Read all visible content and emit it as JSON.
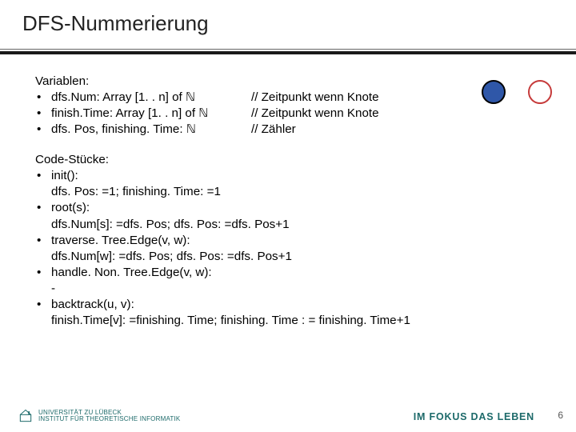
{
  "title": "DFS-Nummerierung",
  "variables": {
    "heading": "Variablen:",
    "items": [
      {
        "decl": "dfs.Num: Array [1. . n] of ℕ",
        "comment": "// Zeitpunkt wenn Knote"
      },
      {
        "decl": "finish.Time: Array [1. . n] of ℕ",
        "comment": "// Zeitpunkt wenn Knote"
      },
      {
        "decl": "dfs. Pos, finishing. Time: ℕ",
        "comment": "// Zähler"
      }
    ]
  },
  "code": {
    "heading": "Code-Stücke:",
    "items": [
      {
        "name": "init():",
        "body": "dfs. Pos: =1; finishing. Time: =1"
      },
      {
        "name": "root(s):",
        "body": "dfs.Num[s]: =dfs. Pos; dfs. Pos: =dfs. Pos+1"
      },
      {
        "name": "traverse. Tree.Edge(v, w):",
        "body": "dfs.Num[w]: =dfs. Pos; dfs. Pos: =dfs. Pos+1"
      },
      {
        "name": "handle. Non. Tree.Edge(v, w):",
        "body": "-"
      },
      {
        "name": "backtrack(u, v):",
        "body": "finish.Time[v]: =finishing. Time; finishing. Time : = finishing. Time+1"
      }
    ]
  },
  "footer": {
    "logo_line1": "UNIVERSITÄT ZU LÜBECK",
    "logo_line2": "INSTITUT FÜR THEORETISCHE INFORMATIK",
    "tagline": "IM FOKUS DAS LEBEN",
    "page": "6"
  }
}
